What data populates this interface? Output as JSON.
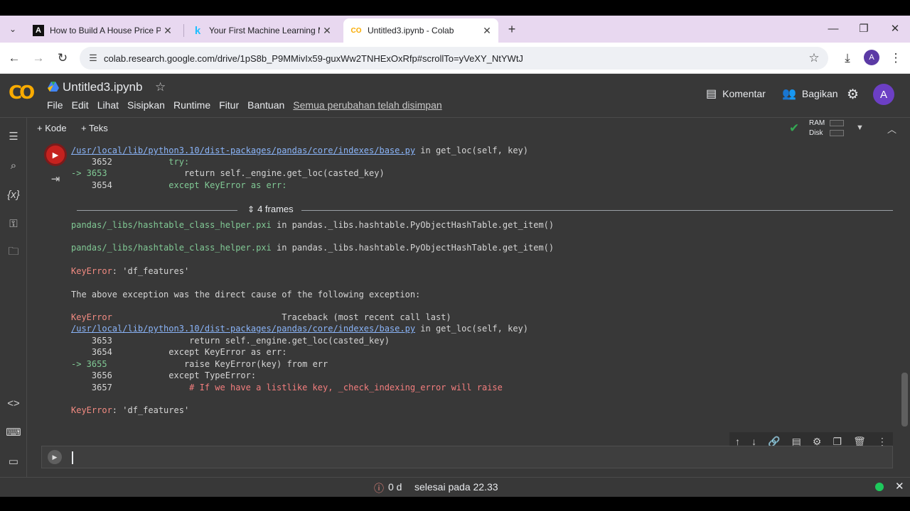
{
  "browser": {
    "tabs": [
      {
        "title": "How to Build A House Price Pre",
        "favicon": "A",
        "active": false
      },
      {
        "title": "Your First Machine Learning Mo",
        "favicon": "k",
        "active": false
      },
      {
        "title": "Untitled3.ipynb - Colab",
        "favicon": "CO",
        "active": true
      }
    ],
    "url": "colab.research.google.com/drive/1pS8b_P9MMivIx59-guxWw2TNHExOxRfp#scrollTo=yVeXY_NtYWtJ",
    "profile_initial": "A"
  },
  "colab": {
    "notebook_title": "Untitled3.ipynb",
    "menu": [
      "File",
      "Edit",
      "Lihat",
      "Sisipkan",
      "Runtime",
      "Fitur",
      "Bantuan"
    ],
    "save_status": "Semua perubahan telah disimpan",
    "comment_label": "Komentar",
    "share_label": "Bagikan",
    "avatar_initial": "A",
    "toolbar": {
      "add_code": "Kode",
      "add_text": "Teks",
      "ram_label": "RAM",
      "disk_label": "Disk"
    }
  },
  "output": {
    "tb1_file": "/usr/local/lib/python3.10/dist-packages/pandas/core/indexes/base.py",
    "tb1_in": " in get_loc(self, key)",
    "tb1_l1_no": "    3652",
    "tb1_l1_code": "           try:",
    "tb1_l2_no": "-> 3653",
    "tb1_l2_code": "               return self._engine.get_loc(casted_key)",
    "tb1_l3_no": "    3654",
    "tb1_l3_code": "           except KeyError as err:",
    "frames_label": "4 frames",
    "hash1_file": "pandas/_libs/hashtable_class_helper.pxi",
    "hash1_in": " in pandas._libs.hashtable.PyObjectHashTable.get_item()",
    "hash2_file": "pandas/_libs/hashtable_class_helper.pxi",
    "hash2_in": " in pandas._libs.hashtable.PyObjectHashTable.get_item()",
    "key_error1_name": "KeyError",
    "key_error1_msg": ": 'df_features'",
    "cause_msg": "The above exception was the direct cause of the following exception:",
    "tb2_header_name": "KeyError",
    "tb2_header_rest": "                                 Traceback (most recent call last)",
    "tb2_file": "/usr/local/lib/python3.10/dist-packages/pandas/core/indexes/base.py",
    "tb2_in": " in get_loc(self, key)",
    "tb2_l1_no": "    3653",
    "tb2_l1_code": "               return self._engine.get_loc(casted_key)",
    "tb2_l2_no": "    3654",
    "tb2_l2_code": "           except KeyError as err:",
    "tb2_l3_no": "-> 3655",
    "tb2_l3_code": "               raise KeyError(key) from err",
    "tb2_l4_no": "    3656",
    "tb2_l4_code": "           except TypeError:",
    "tb2_l5_no": "    3657",
    "tb2_l5_code": "               # If we have a listlike key, _check_indexing_error will raise",
    "key_error2_name": "KeyError",
    "key_error2_msg": ": 'df_features'"
  },
  "status": {
    "elapsed": "0 d",
    "completed": "selesai pada 22.33"
  },
  "colors": {
    "accent_error": "#c5221f",
    "link": "#8ab4f8",
    "success": "#34a853",
    "background": "#383838"
  }
}
